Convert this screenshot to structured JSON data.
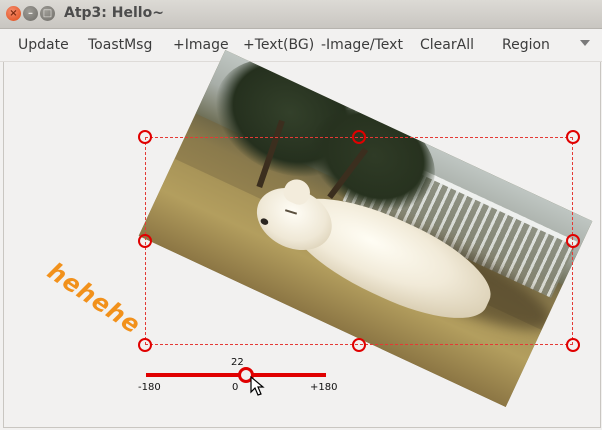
{
  "window": {
    "title": "Atp3: Hello~",
    "controls": [
      "close",
      "minimize",
      "maximize"
    ]
  },
  "toolbar": {
    "items": [
      "Update",
      "ToastMsg",
      "+Image",
      "+Text(BG)",
      "-Image/Text",
      "ClearAll",
      "Region"
    ],
    "overflow": "chevron-down-icon"
  },
  "canvas": {
    "overlay_text": "hehehe",
    "overlay_text_color": "#f2911b",
    "image_rotation_deg": 25,
    "selection_color": "#e00000"
  },
  "slider": {
    "value": "22",
    "min_label": "-180",
    "mid_label": "0",
    "max_label": "+180",
    "color": "#e00000"
  }
}
